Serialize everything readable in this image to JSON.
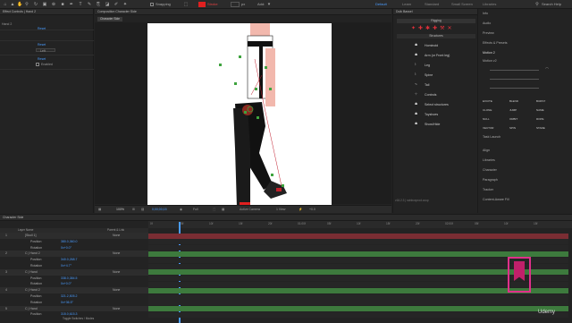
{
  "toolbar": {
    "snapping": "Snapping",
    "stroke": "Stroke",
    "stroke_width": "px",
    "add": "Add:",
    "workspaces": [
      "Default",
      "Learn",
      "Standard",
      "Small Screen",
      "Libraries"
    ],
    "search": "Search Help"
  },
  "effect_controls": {
    "title": "Effect Controls | Hand 2",
    "layer": "Hand 2",
    "reset_labels": [
      "Reset",
      "Reset",
      "Reset"
    ],
    "left_value": "Left",
    "enabled": "Enabled"
  },
  "composition": {
    "tab": "Composition Character Side",
    "flow_tab": "Character Side",
    "zoom": "100%",
    "time": "0;00;00;15",
    "quality": "Full",
    "camera": "Active Camera",
    "views": "1 View",
    "exposure": "+0.0"
  },
  "duik": {
    "title": "Duik Bassel",
    "section": "Rigging",
    "structures": "Structures",
    "items": [
      "Hominoid",
      "Arm (or Front leg)",
      "Leg",
      "Spine",
      "Tail",
      "Controls",
      "Select structures",
      "Toyshoes",
      "Show/Hide"
    ],
    "footer": "v16.2.3 | rainboxprod.coop"
  },
  "motion": {
    "title": "Motion 2",
    "version": "Motion v2",
    "buttons": [
      "EXCITE",
      "BLEND",
      "BURST",
      "CLONE",
      "JUMP",
      "NAME",
      "NULL",
      "ORBIT",
      "ROPE",
      "VECTOR",
      "SPIN",
      "STARE"
    ],
    "task": "Task Launch"
  },
  "right_panels": {
    "top": [
      "Info",
      "Audio",
      "Preview",
      "Effects & Presets"
    ],
    "bottom": [
      "Align",
      "Libraries",
      "Character",
      "Paragraph",
      "Tracker",
      "Content-Aware Fill"
    ]
  },
  "timeline": {
    "tab": "Character Side",
    "col_source": "Layer Name",
    "col_parent": "Parent & Link",
    "layers": [
      {
        "num": "1",
        "name": "[Skull 1]",
        "parent": "None"
      },
      {
        "num": "",
        "name": "Position",
        "value": "380.0,360.0"
      },
      {
        "num": "",
        "name": "Rotation",
        "value": "0x+0.0°"
      },
      {
        "num": "2",
        "name": "C | Hand 2",
        "parent": "None"
      },
      {
        "num": "",
        "name": "Position",
        "value": "340.0,268.7"
      },
      {
        "num": "",
        "name": "Rotation",
        "value": "0x+4.7°"
      },
      {
        "num": "3",
        "name": "C | Hand",
        "parent": "None"
      },
      {
        "num": "",
        "name": "Position",
        "value": "338.0,384.5"
      },
      {
        "num": "",
        "name": "Rotation",
        "value": "0x+0.0°"
      },
      {
        "num": "4",
        "name": "C | Hand 2",
        "parent": "None"
      },
      {
        "num": "",
        "name": "Position",
        "value": "321.2,505.2"
      },
      {
        "num": "",
        "name": "Rotation",
        "value": "0x+36.5°"
      },
      {
        "num": "5",
        "name": "C | Hand",
        "parent": "None"
      },
      {
        "num": "",
        "name": "Position",
        "value": "315.0,615.3"
      }
    ],
    "toggle": "Toggle Switches / Modes",
    "ruler": [
      "0f",
      "05f",
      "10f",
      "15f",
      "20f",
      "01:00f",
      "05f",
      "10f",
      "15f",
      "20f",
      "02:00f",
      "05f",
      "10f",
      "15f"
    ]
  },
  "watermark": "Udemy",
  "colors": {
    "accent": "#4a9cff",
    "stroke_swatch": "#e02020",
    "red_track": "#7a2d33",
    "green_track": "#3d7a3d"
  }
}
